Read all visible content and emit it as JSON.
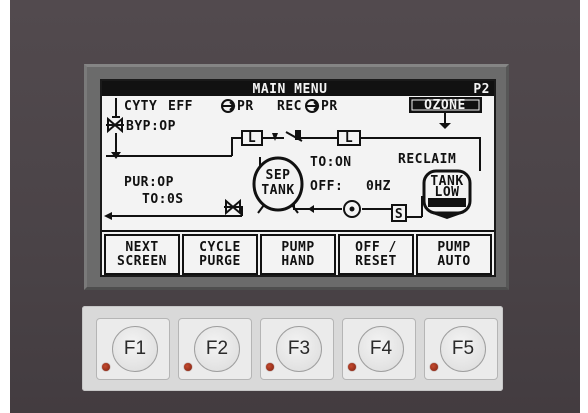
{
  "screen": {
    "title": "MAIN MENU",
    "page": "P2",
    "labels": {
      "cyty": "CYTY",
      "eff": "EFF",
      "pr1": "PR",
      "rec": "REC",
      "pr2": "PR",
      "ozone": "OZONE",
      "byp": "BYP:OP",
      "to_on": "TO:ON",
      "reclaim": "RECLAIM",
      "pur": "PUR:OP",
      "to_os": "TO:0S",
      "sep": "SEP",
      "tank": "TANK",
      "off": "OFF:",
      "ohz": "0HZ",
      "tank_low_1": "TANK",
      "tank_low_2": "LOW",
      "s": "S",
      "l1": "L",
      "l2": "L"
    }
  },
  "softkeys": [
    {
      "line1": "NEXT",
      "line2": "SCREEN"
    },
    {
      "line1": "CYCLE",
      "line2": "PURGE"
    },
    {
      "line1": "PUMP",
      "line2": "HAND"
    },
    {
      "line1": "OFF /",
      "line2": "RESET"
    },
    {
      "line1": "PUMP",
      "line2": "AUTO"
    }
  ],
  "function_keys": [
    {
      "label": "F1"
    },
    {
      "label": "F2"
    },
    {
      "label": "F3"
    },
    {
      "label": "F4"
    },
    {
      "label": "F5"
    }
  ],
  "colors": {
    "lcd_background": "#f3f3f3",
    "lcd_ink": "#111111",
    "panel": "#4a4347",
    "bezel": "#6b6b6b",
    "keypad": "#d9d9d9",
    "led": "#a83a22"
  }
}
